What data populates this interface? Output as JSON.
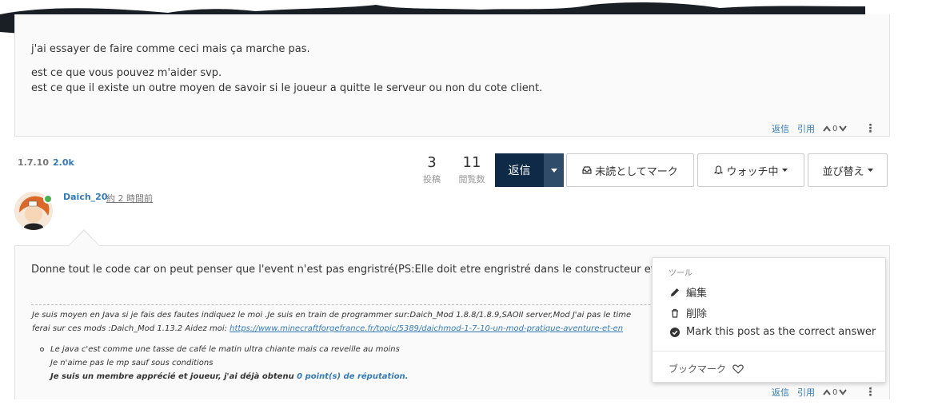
{
  "post1": {
    "lines": [
      "j'ai essayer de faire comme ceci mais ça marche pas.",
      "est ce que vous pouvez m'aider svp.",
      "est ce que il existe un outre moyen de savoir si le joueur a quitte le serveur ou non du cote client."
    ],
    "actions": {
      "reply": "返信",
      "quote": "引用",
      "votes": "0"
    }
  },
  "topic": {
    "tag_version": "1.7.10",
    "tag_views": "2.0k",
    "posts_count": "3",
    "posts_label": "投稿",
    "views_count": "11",
    "views_label": "閲覧数",
    "reply_button": "返信",
    "mark_unread": "未読としてマーク",
    "watching": "ウォッチ中",
    "sort": "並び替え"
  },
  "post2": {
    "author": "Daich_20",
    "time": "約 2 時間前",
    "text": "Donne tout le code car on peut penser que l'event n'est pas engristré(PS:Elle doit etre engristré dans le constructeur et tor",
    "sig_line1": "Je suis moyen en Java si je fais des fautes indiquez le moi .Je suis en train de programmer sur:Daich_Mod 1.8.8/1.8.9,SAOII server,Mod J'ai pas le time",
    "sig_line2_prefix": "ferai sur ces mods :Daich_Mod 1.13.2 Aidez moi: ",
    "sig_link": "https://www.minecraftforgefrance.fr/topic/5389/daichmod-1-7-10-un-mod-pratique-aventure-et-en",
    "list_line1": "Le java c'est comme une tasse de café le matin ultra chiante mais ca reveille au moins",
    "list_line2": "Je n'aime pas le mp sauf sous conditions",
    "list_line3_prefix": "Je suis un membre apprécié et joueur, j'ai déjà obtenu ",
    "list_line3_rep": "0 point(s) de réputation.",
    "actions": {
      "reply": "返信",
      "quote": "引用",
      "votes": "0"
    }
  },
  "menu": {
    "header": "ツール",
    "edit": "編集",
    "delete": "削除",
    "mark_correct": "Mark this post as the correct answer",
    "bookmark": "ブックマーク"
  },
  "colors": {
    "reply_bg": "#0e2a47",
    "link": "#337ab7",
    "online": "#4caf50"
  }
}
